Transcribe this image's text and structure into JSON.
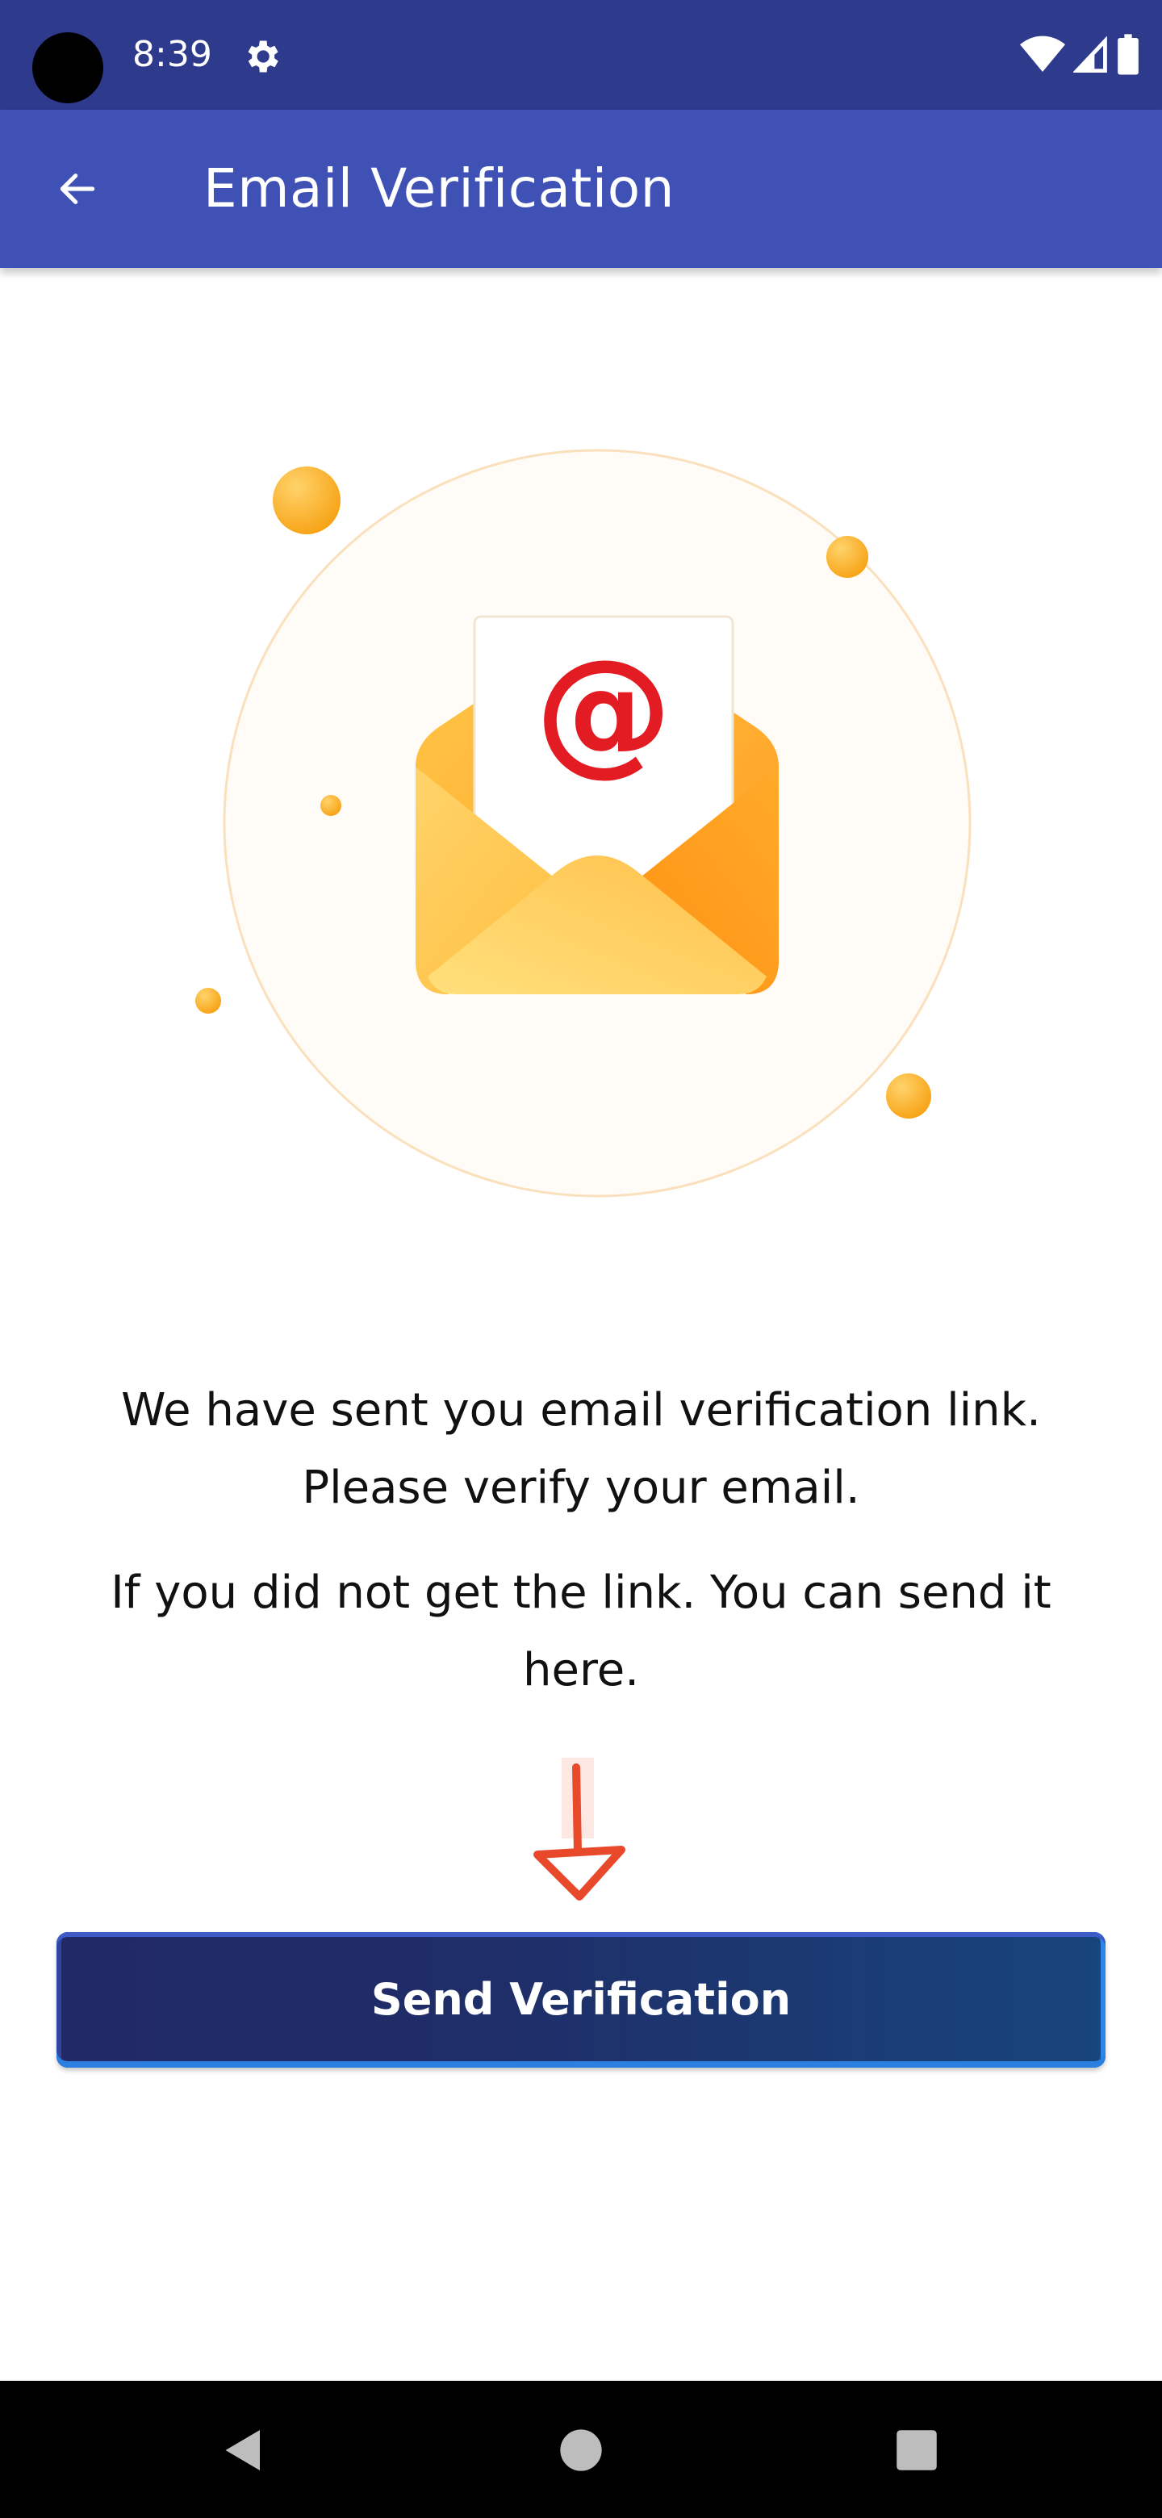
{
  "status_bar": {
    "time": "8:39",
    "icons": [
      "settings-icon",
      "wifi-icon",
      "signal-icon",
      "battery-icon"
    ]
  },
  "app_bar": {
    "title": "Email Verification",
    "back_icon": "arrow-left-icon",
    "background": "#3f51b5"
  },
  "illustration": {
    "icon": "open-envelope-with-at-sign",
    "symbol": "@",
    "accent": "#e8232a",
    "envelope_color": "#ffb733"
  },
  "message": {
    "line1": "We have sent you email verification link. Please verify your email.",
    "line2": "If you did not get the link. You can send it here."
  },
  "arrow_icon": "arrow-down-icon",
  "send_button": {
    "label": "Send Verification"
  },
  "nav_bar": {
    "icons": [
      "back-triangle-icon",
      "home-circle-icon",
      "recents-square-icon"
    ]
  }
}
